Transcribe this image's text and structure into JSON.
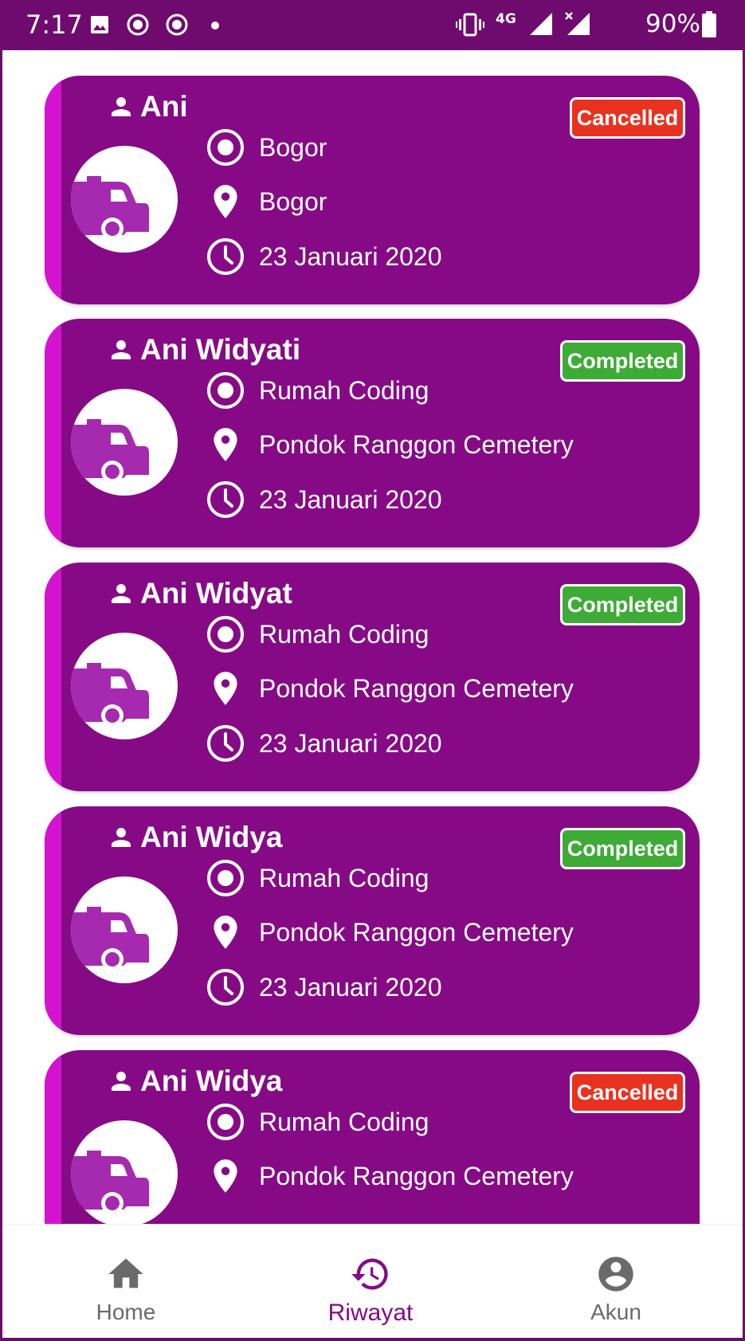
{
  "status_bar": {
    "time": "7:17",
    "network": "4G",
    "battery": "90%"
  },
  "trips": [
    {
      "name": "Ani",
      "origin": "Bogor",
      "destination": "Bogor",
      "date": "23 Januari 2020",
      "status": "Cancelled"
    },
    {
      "name": "Ani Widyati",
      "origin": "Rumah Coding",
      "destination": "Pondok Ranggon Cemetery",
      "date": "23 Januari 2020",
      "status": "Completed"
    },
    {
      "name": "Ani Widyat",
      "origin": "Rumah Coding",
      "destination": "Pondok Ranggon Cemetery",
      "date": "23 Januari 2020",
      "status": "Completed"
    },
    {
      "name": "Ani Widya",
      "origin": "Rumah Coding",
      "destination": "Pondok Ranggon Cemetery",
      "date": "23 Januari 2020",
      "status": "Completed"
    },
    {
      "name": "Ani Widya",
      "origin": "Rumah Coding",
      "destination": "Pondok Ranggon Cemetery",
      "date": "",
      "status": "Cancelled"
    }
  ],
  "bottom_nav": {
    "items": [
      {
        "label": "Home",
        "icon": "home-icon",
        "active": false
      },
      {
        "label": "Riwayat",
        "icon": "history-icon",
        "active": true
      },
      {
        "label": "Akun",
        "icon": "account-icon",
        "active": false
      }
    ]
  },
  "colors": {
    "card": "#860a86",
    "accent_stripe": "#d413d1",
    "status_bar": "#6f0a6e",
    "cancelled": "#e8321f",
    "completed": "#3dab36",
    "active_nav": "#860a86"
  }
}
